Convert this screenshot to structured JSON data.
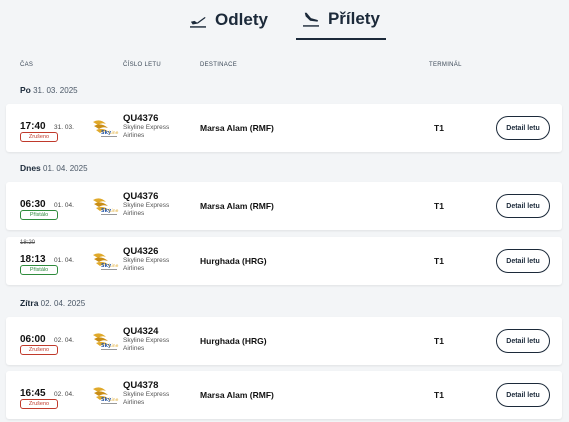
{
  "tabs": [
    {
      "label": "Odlety",
      "icon": "plane-departure-icon"
    },
    {
      "label": "Přílety",
      "icon": "plane-arrival-icon",
      "active": true
    }
  ],
  "columns": {
    "time": "ČAS",
    "flight": "ČÍSLO LETU",
    "destination": "DESTINACE",
    "terminal": "TERMINÁL"
  },
  "days": [
    {
      "prefix": "Po",
      "date": "31. 03. 2025"
    },
    {
      "prefix": "Dnes",
      "date": "01. 04. 2025"
    },
    {
      "prefix": "Zítra",
      "date": "02. 04. 2025"
    }
  ],
  "flights": [
    {
      "scheduled": "",
      "time": "17:40",
      "date": "31. 03.",
      "status": "Zrušeno",
      "status_color": "#c0392b",
      "flight_no": "QU4376",
      "airline_line1": "Skyline Express",
      "airline_line2": "Airlines",
      "destination": "Marsa Alam (RMF)",
      "terminal": "T1",
      "button": "Detail letu"
    },
    {
      "scheduled": "",
      "time": "06:30",
      "date": "01. 04.",
      "status": "Přistálo",
      "status_color": "#2e8b3c",
      "flight_no": "QU4376",
      "airline_line1": "Skyline Express",
      "airline_line2": "Airlines",
      "destination": "Marsa Alam (RMF)",
      "terminal": "T1",
      "button": "Detail letu"
    },
    {
      "scheduled": "18:20",
      "time": "18:13",
      "date": "01. 04.",
      "status": "Přistálo",
      "status_color": "#2e8b3c",
      "flight_no": "QU4326",
      "airline_line1": "Skyline Express",
      "airline_line2": "Airlines",
      "destination": "Hurghada (HRG)",
      "terminal": "T1",
      "button": "Detail letu"
    },
    {
      "scheduled": "",
      "time": "06:00",
      "date": "02. 04.",
      "status": "Zrušeno",
      "status_color": "#c0392b",
      "flight_no": "QU4324",
      "airline_line1": "Skyline Express",
      "airline_line2": "Airlines",
      "destination": "Hurghada (HRG)",
      "terminal": "T1",
      "button": "Detail letu"
    },
    {
      "scheduled": "",
      "time": "16:45",
      "date": "02. 04.",
      "status": "Zrušeno",
      "status_color": "#c0392b",
      "flight_no": "QU4378",
      "airline_line1": "Skyline Express",
      "airline_line2": "Airlines",
      "destination": "Marsa Alam (RMF)",
      "terminal": "T1",
      "button": "Detail letu"
    }
  ],
  "colors": {
    "text": "#1c2a3a",
    "cancelled": "#c0392b",
    "landed": "#2e8b3c",
    "logo_gold": "#e0a92a"
  }
}
